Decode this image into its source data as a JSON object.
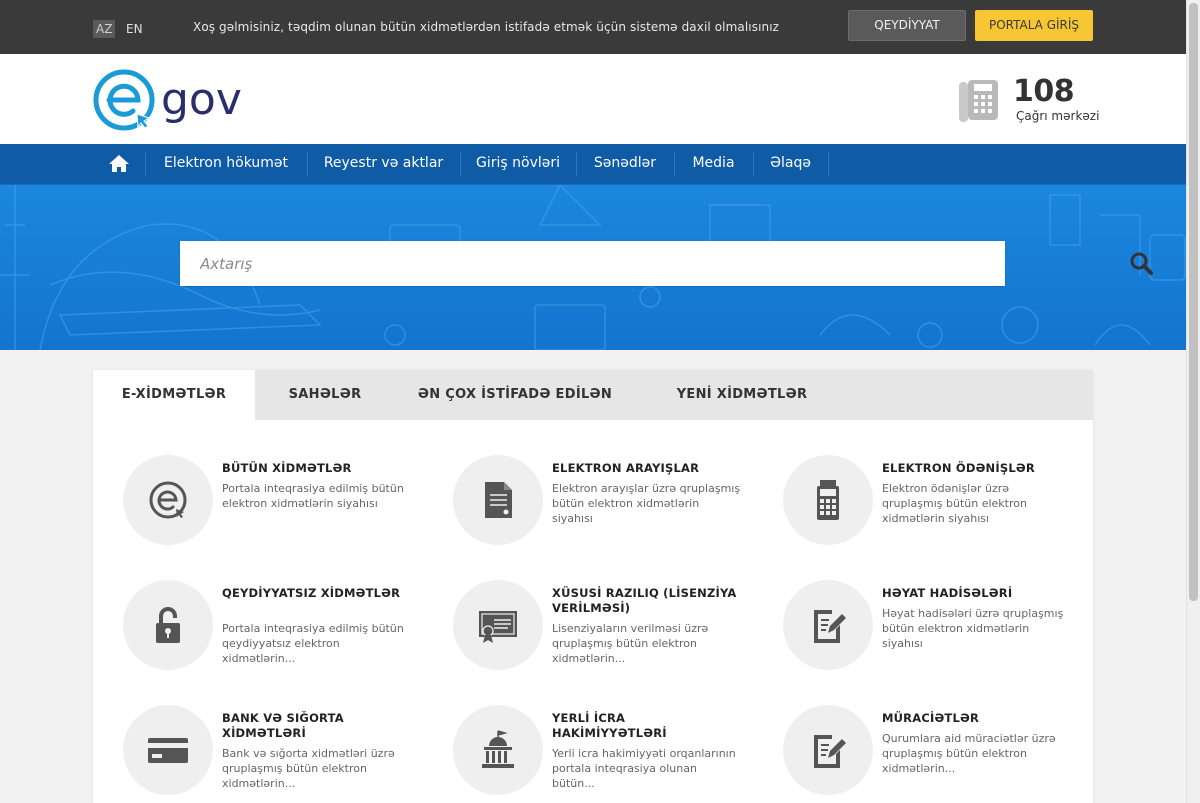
{
  "topbar": {
    "lang_az": "AZ",
    "lang_en": "EN",
    "welcome": "Xoş gəlmisiniz, təqdim olunan bütün xidmətlərdən istifadə etmək üçün sistemə daxil olmalısınız",
    "register_label": "QEYDİYYAT",
    "login_label": "PORTALA GİRİŞ"
  },
  "header": {
    "logo_text": "gov",
    "hotline_number": "108",
    "hotline_label": "Çağrı mərkəzi"
  },
  "nav": {
    "items": [
      "Elektron hökumət",
      "Reyestr və aktlar",
      "Giriş növləri",
      "Sənədlər",
      "Media",
      "Əlaqə"
    ]
  },
  "search": {
    "placeholder": "Axtarış"
  },
  "tabs": [
    "E-XİDMƏTLƏR",
    "SAHƏLƏR",
    "ƏN ÇOX İSTİFADƏ EDİLƏN",
    "YENİ XİDMƏTLƏR"
  ],
  "services": [
    {
      "title": "BÜTÜN XİDMƏTLƏR",
      "desc": "Portala inteqrasiya edilmiş bütün elektron xidmətlərin siyahısı",
      "icon": "egov-icon"
    },
    {
      "title": "ELEKTRON ARAYIŞLAR",
      "desc": "Elektron arayışlar üzrə qruplaşmış bütün elektron xidmətlərin siyahısı",
      "icon": "document-icon"
    },
    {
      "title": "ELEKTRON ÖDƏNİŞLƏR",
      "desc": "Elektron ödənişlər üzrə qruplaşmış bütün elektron xidmətlərin siyahısı",
      "icon": "calculator-icon"
    },
    {
      "title": "QEYDİYYATSIZ XİDMƏTLƏR",
      "desc": "Portala inteqrasiya edilmiş bütün qeydiyyatsız elektron xidmətlərin...",
      "icon": "unlock-icon"
    },
    {
      "title": "XÜSUSİ RAZILIQ (LİSENZİYA VERİLMƏSİ)",
      "desc": "Lisenziyaların verilməsi üzrə qruplaşmış bütün elektron xidmətlərin...",
      "icon": "certificate-icon"
    },
    {
      "title": "HƏYAT HADİSƏLƏRİ",
      "desc": "Həyat hadisələri üzrə qruplaşmış bütün elektron xidmətlərin siyahısı",
      "icon": "edit-document-icon"
    },
    {
      "title": "BANK VƏ SIĞORTA XİDMƏTLƏRİ",
      "desc": "Bank və sığorta xidmətləri üzrə qruplaşmış bütün elektron xidmətlərin...",
      "icon": "credit-card-icon"
    },
    {
      "title": "YERLİ İCRA HAKİMİYYƏTLƏRİ",
      "desc": "Yerli icra hakimiyyəti orqanlarının portala inteqrasiya olunan bütün...",
      "icon": "government-building-icon"
    },
    {
      "title": "MÜRACİƏTLƏR",
      "desc": "Qurumlara aid müraciətlər üzrə qruplaşmış bütün elektron xidmətlərin...",
      "icon": "edit-document-icon"
    }
  ],
  "colors": {
    "topbar": "#3a3a3a",
    "nav": "#0f5ba6",
    "hero": "#1474cf",
    "login_button": "#f6c733",
    "logo_blue": "#1a9ad6",
    "logo_navy": "#2a2f6b"
  }
}
